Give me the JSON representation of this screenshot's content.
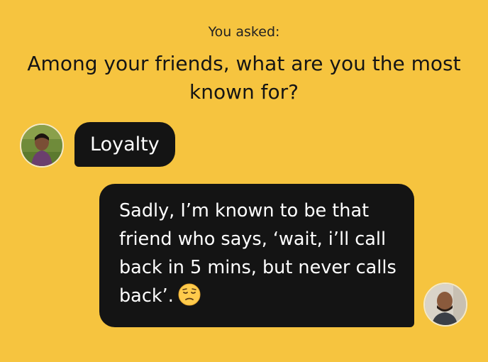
{
  "prompt": {
    "label": "You asked:",
    "question": "Among your friends, what are you the most known for?"
  },
  "answer_bubble": {
    "text": "Loyalty"
  },
  "reply_bubble": {
    "text": "Sadly, I’m known to be that friend who says, ‘wait, i’ll call back in 5 mins, but never calls back’.",
    "emoji": "pensive-face-emoji"
  },
  "colors": {
    "background": "#F6C43F",
    "bubble": "#141414",
    "bubble_text": "#FFFFFF"
  }
}
